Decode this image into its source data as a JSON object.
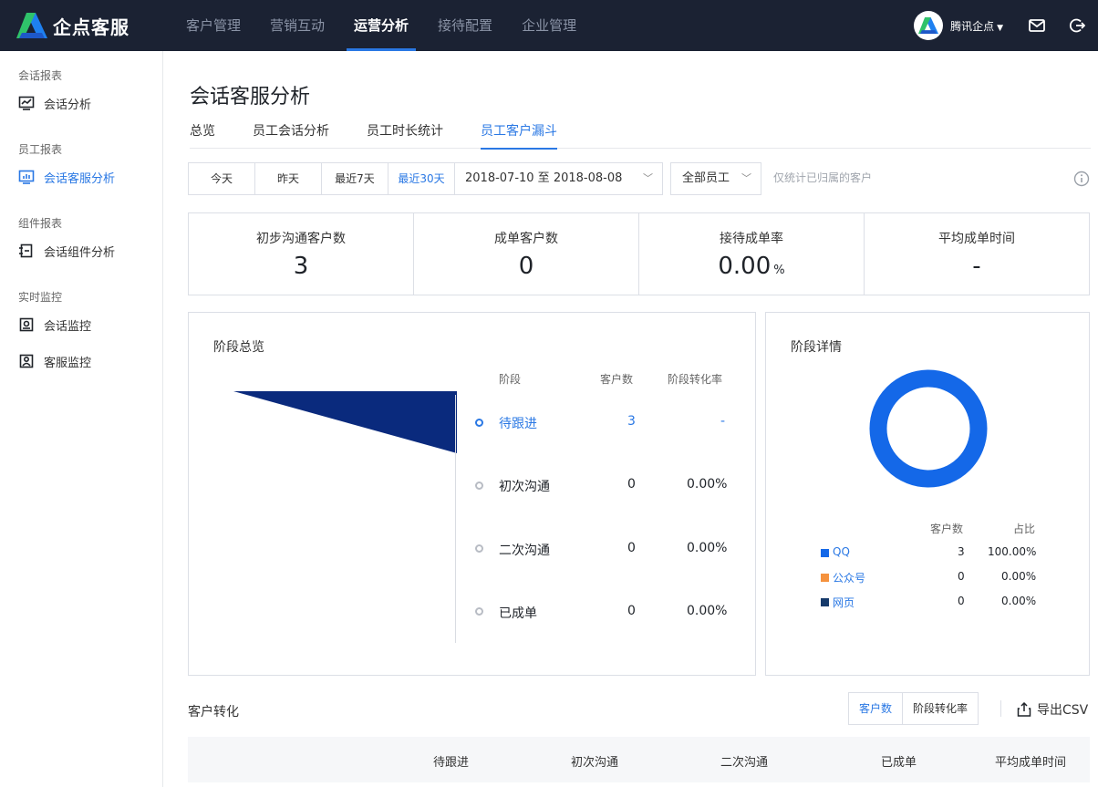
{
  "app": {
    "brand": "企点客服",
    "nav": [
      "客户管理",
      "营销互动",
      "运营分析",
      "接待配置",
      "企业管理"
    ],
    "nav_active": 2,
    "user": "腾讯企点",
    "accent": "#2a78e4",
    "dark": "#1b2233"
  },
  "sidebar": {
    "groups": [
      {
        "title": "会话报表",
        "items": [
          {
            "label": "会话分析",
            "icon": "line-chart-icon"
          }
        ]
      },
      {
        "title": "员工报表",
        "items": [
          {
            "label": "会话客服分析",
            "icon": "bar-chart-icon",
            "active": true
          }
        ]
      },
      {
        "title": "组件报表",
        "items": [
          {
            "label": "会话组件分析",
            "icon": "component-icon"
          }
        ]
      },
      {
        "title": "实时监控",
        "items": [
          {
            "label": "会话监控",
            "icon": "monitor-icon"
          },
          {
            "label": "客服监控",
            "icon": "agent-monitor-icon"
          }
        ]
      }
    ]
  },
  "page": {
    "title": "会话客服分析",
    "tabs": [
      "总览",
      "员工会话分析",
      "员工时长统计",
      "员工客户漏斗"
    ],
    "active_tab": 3
  },
  "filters": {
    "ranges": [
      "今天",
      "昨天",
      "最近7天",
      "最近30天"
    ],
    "active_range": 3,
    "date_range": "2018-07-10 至 2018-08-08",
    "staff": "全部员工",
    "note": "仅统计已归属的客户"
  },
  "stats": [
    {
      "label": "初步沟通客户数",
      "value": "3",
      "unit": ""
    },
    {
      "label": "成单客户数",
      "value": "0",
      "unit": ""
    },
    {
      "label": "接待成单率",
      "value": "0.00",
      "unit": "%"
    },
    {
      "label": "平均成单时间",
      "value": "-",
      "unit": ""
    }
  ],
  "funnel": {
    "title": "阶段总览",
    "headers": {
      "stage": "阶段",
      "count": "客户数",
      "rate": "阶段转化率"
    },
    "stages": [
      {
        "name": "待跟进",
        "count": "3",
        "rate": "-",
        "active": true
      },
      {
        "name": "初次沟通",
        "count": "0",
        "rate": "0.00%"
      },
      {
        "name": "二次沟通",
        "count": "0",
        "rate": "0.00%"
      },
      {
        "name": "已成单",
        "count": "0",
        "rate": "0.00%"
      }
    ],
    "color": "#0a2a7d"
  },
  "detail": {
    "title": "阶段详情",
    "headers": {
      "count": "客户数",
      "share": "占比"
    },
    "sources": [
      {
        "name": "QQ",
        "count": "3",
        "share": "100.00%",
        "color": "#1468e8"
      },
      {
        "name": "公众号",
        "count": "0",
        "share": "0.00%",
        "color": "#f5923e"
      },
      {
        "name": "网页",
        "count": "0",
        "share": "0.00%",
        "color": "#163a6b"
      }
    ]
  },
  "conversion": {
    "title": "客户转化",
    "toggle": [
      "客户数",
      "阶段转化率"
    ],
    "export": "导出CSV",
    "columns": [
      "待跟进",
      "初次沟通",
      "二次沟通",
      "已成单",
      "平均成单时间"
    ]
  }
}
